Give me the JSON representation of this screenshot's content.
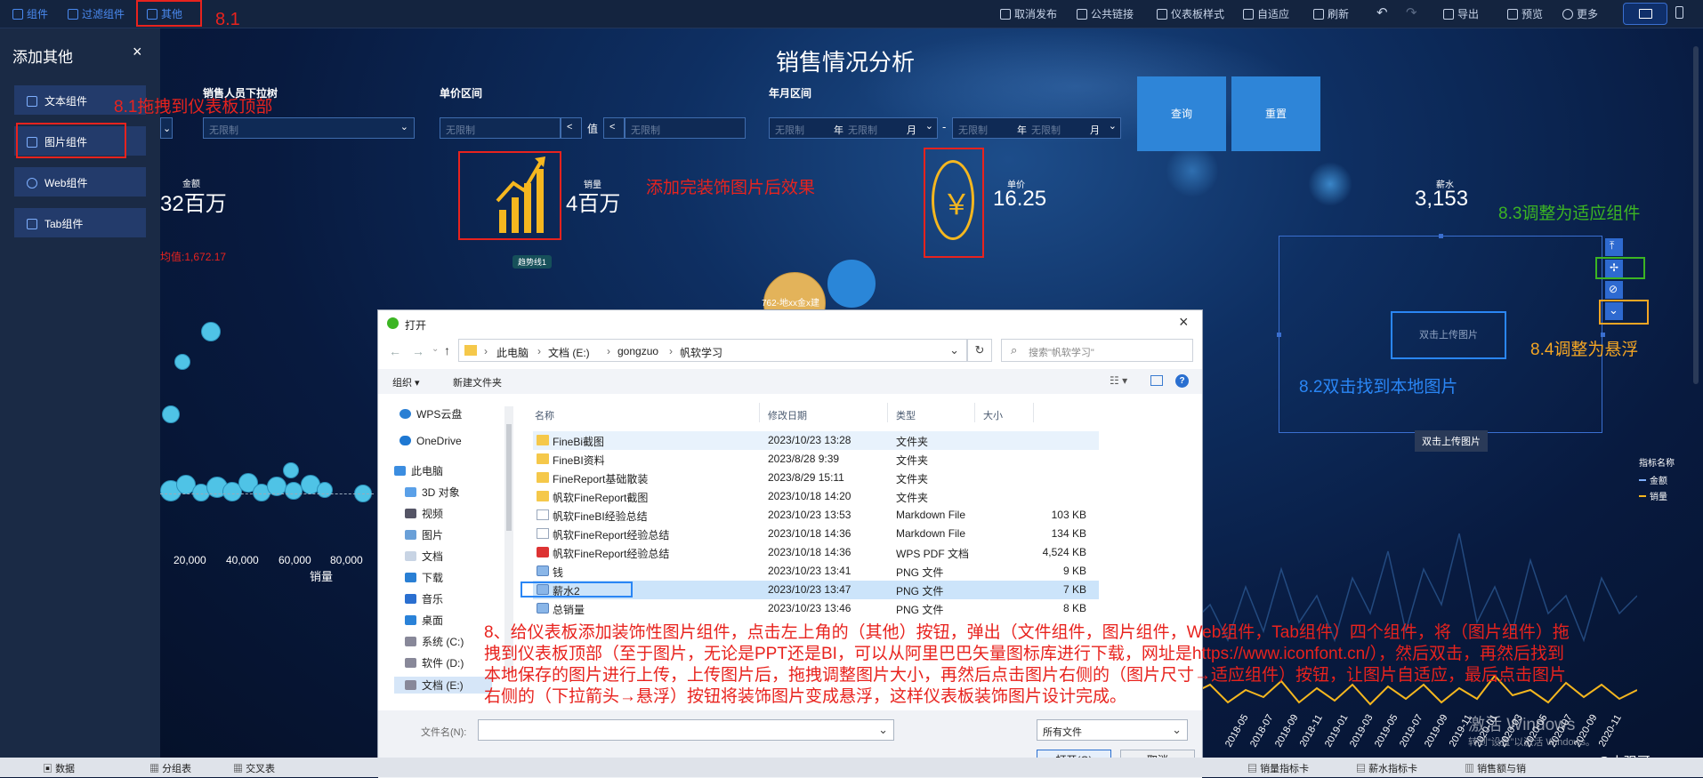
{
  "toolbar": {
    "left": [
      {
        "label": "组件",
        "icon": "component-icon"
      },
      {
        "label": "过滤组件",
        "icon": "filter-icon"
      },
      {
        "label": "其他",
        "icon": "other-icon"
      }
    ],
    "right": [
      {
        "label": "取消发布",
        "icon": "unpublish-icon"
      },
      {
        "label": "公共链接",
        "icon": "link-icon"
      },
      {
        "label": "仪表板样式",
        "icon": "style-icon"
      },
      {
        "label": "自适应",
        "icon": "fit-icon"
      },
      {
        "label": "刷新",
        "icon": "refresh-icon"
      },
      {
        "label": "导出",
        "icon": "export-icon"
      },
      {
        "label": "预览",
        "icon": "preview-icon"
      },
      {
        "label": "更多",
        "icon": "more-icon"
      }
    ]
  },
  "panel": {
    "title": "添加其他",
    "items": [
      "文本组件",
      "图片组件",
      "Web组件",
      "Tab组件"
    ]
  },
  "dashboard": {
    "title": "销售情况分析",
    "filters": {
      "salesperson_label": "销售人员下拉树",
      "salesperson_value": "无限制",
      "price_label": "单价区间",
      "price_min": "无限制",
      "price_max": "无限制",
      "price_mid": "值",
      "date_label": "年月区间",
      "date_start_year": "无限制",
      "date_start_month": "无限制",
      "date_end_year": "无限制",
      "date_end_month": "无限制",
      "year_unit": "年",
      "month_unit": "月",
      "dash": "-"
    },
    "buttons": {
      "query": "查询",
      "reset": "重置"
    },
    "kpis": [
      {
        "title": "金额",
        "value": "32百万"
      },
      {
        "title": "销量",
        "value": "4百万"
      },
      {
        "title": "单价",
        "value": "16.25"
      },
      {
        "title": "薪水",
        "value": "3,153"
      }
    ],
    "avg_label": "均值:1,672.17",
    "trend_tag": "趋势线1",
    "bubble_label": "762-地xx金x建",
    "image_placeholder": "双击上传图片",
    "image_tooltip": "双击上传图片",
    "legend": {
      "title": "指标名称",
      "items": [
        "金额",
        "销量"
      ]
    },
    "x_axis": {
      "ticks": [
        "20,000",
        "40,000",
        "60,000",
        "80,000"
      ],
      "label": "销量"
    },
    "dates": [
      "2018-05",
      "2018-07",
      "2018-09",
      "2018-11",
      "2019-01",
      "2019-03",
      "2019-05",
      "2019-07",
      "2019-09",
      "2019-11",
      "2020-01",
      "2020-03",
      "2020-05",
      "2020-07",
      "2020-09",
      "2020-11"
    ],
    "watermark": [
      "激活 Windows",
      "转到“设置”以激活 Windows。"
    ],
    "csdn": "CSDN @大强哥666"
  },
  "colors": {
    "accent": "#2e85d8",
    "annotation": "#e8231e",
    "green": "#3cb523",
    "blue": "#2a86f5",
    "orange": "#f5a623",
    "kpi_icon": "#f5b71f"
  },
  "annotations": {
    "a81": "8.1",
    "a81drag": "8.1拖拽到仪表板顶部",
    "after": "添加完装饰图片后效果",
    "a82": "8.2双击找到本地图片",
    "a83": "8.3调整为适应组件",
    "a84": "8.4调整为悬浮",
    "main": "8、给仪表板添加装饰性图片组件，点击左上角的（其他）按钮，弹出（文件组件，图片组件，Web组件，Tab组件）四个组件，将（图片组件）拖拽到仪表板顶部（至于图片，无论是PPT还是BI，可以从阿里巴巴矢量图标库进行下载，网址是https://www.iconfont.cn/），然后双击，再然后找到本地保存的图片进行上传，上传图片后，拖拽调整图片大小，再然后点击图片右侧的（图片尺寸→适应组件）按钮，让图片自适应，最后点击图片右侧的（下拉箭头→悬浮）按钮将装饰图片变成悬浮，这样仪表板装饰图片设计完成。"
  },
  "dialog": {
    "title": "打开",
    "path": [
      "此电脑",
      "文档 (E:)",
      "gongzuo",
      "帆软学习"
    ],
    "search_placeholder": "搜索\"帆软学习\"",
    "organize": "组织 ▾",
    "new_folder": "新建文件夹",
    "tree": [
      "WPS云盘",
      "OneDrive",
      "此电脑",
      "3D 对象",
      "视频",
      "图片",
      "文档",
      "下载",
      "音乐",
      "桌面",
      "系统 (C:)",
      "软件 (D:)",
      "文档 (E:)"
    ],
    "columns": [
      "名称",
      "修改日期",
      "类型",
      "大小"
    ],
    "files": [
      {
        "name": "FineBi截图",
        "date": "2023/10/23 13:28",
        "type": "文件夹",
        "size": "",
        "kind": "folder"
      },
      {
        "name": "FineBI资料",
        "date": "2023/8/28 9:39",
        "type": "文件夹",
        "size": "",
        "kind": "folder"
      },
      {
        "name": "FineReport基础散装",
        "date": "2023/8/29 15:11",
        "type": "文件夹",
        "size": "",
        "kind": "folder"
      },
      {
        "name": "帆软FineReport截图",
        "date": "2023/10/18 14:20",
        "type": "文件夹",
        "size": "",
        "kind": "folder"
      },
      {
        "name": "帆软FineBI经验总结",
        "date": "2023/10/23 13:53",
        "type": "Markdown File",
        "size": "103 KB",
        "kind": "doc"
      },
      {
        "name": "帆软FineReport经验总结",
        "date": "2023/10/18 14:36",
        "type": "Markdown File",
        "size": "134 KB",
        "kind": "doc"
      },
      {
        "name": "帆软FineReport经验总结",
        "date": "2023/10/18 14:36",
        "type": "WPS PDF 文档",
        "size": "4,524 KB",
        "kind": "pdf"
      },
      {
        "name": "钱",
        "date": "2023/10/23 13:41",
        "type": "PNG 文件",
        "size": "9 KB",
        "kind": "png"
      },
      {
        "name": "薪水2",
        "date": "2023/10/23 13:47",
        "type": "PNG 文件",
        "size": "7 KB",
        "kind": "png"
      },
      {
        "name": "总销量",
        "date": "2023/10/23 13:46",
        "type": "PNG 文件",
        "size": "8 KB",
        "kind": "png"
      }
    ],
    "filename_label": "文件名(N):",
    "filetype": "所有文件",
    "open": "打开(O)",
    "cancel": "取消"
  },
  "bottom_tabs": [
    "数据",
    "分组表",
    "交叉表",
    "销量指标卡",
    "薪水指标卡",
    "销售额与销"
  ]
}
